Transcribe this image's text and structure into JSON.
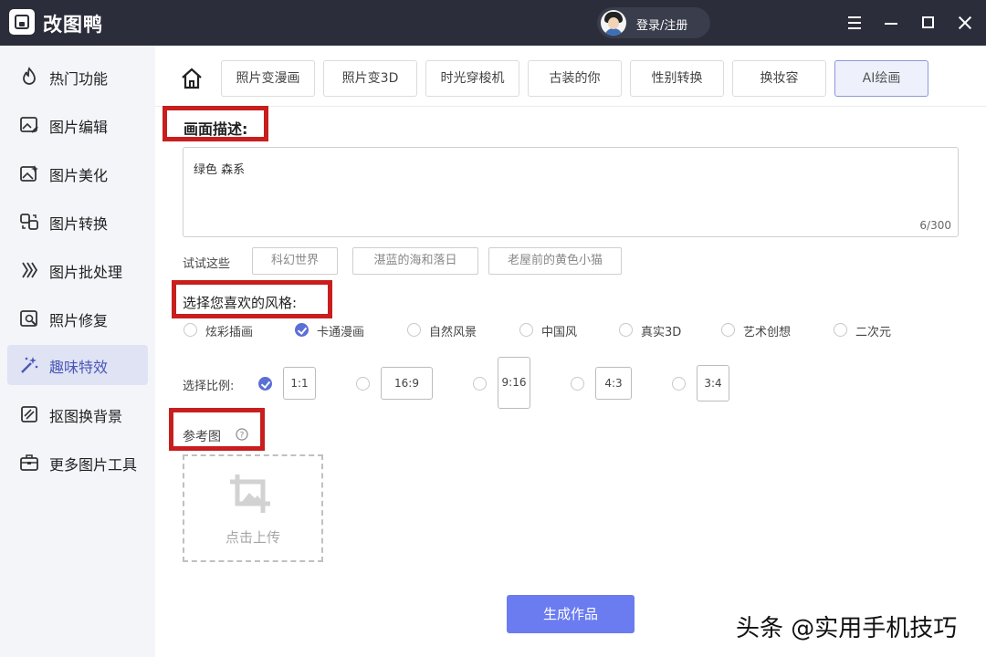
{
  "app": {
    "title": "改图鸭",
    "login_label": "登录/注册"
  },
  "sidebar": {
    "items": [
      {
        "label": "热门功能",
        "icon": "flame-icon"
      },
      {
        "label": "图片编辑",
        "icon": "image-edit-icon"
      },
      {
        "label": "图片美化",
        "icon": "image-beauty-icon"
      },
      {
        "label": "图片转换",
        "icon": "convert-icon"
      },
      {
        "label": "图片批处理",
        "icon": "batch-icon"
      },
      {
        "label": "照片修复",
        "icon": "repair-icon"
      },
      {
        "label": "趣味特效",
        "icon": "magic-wand-icon",
        "active": true
      },
      {
        "label": "抠图换背景",
        "icon": "cutout-icon"
      },
      {
        "label": "更多图片工具",
        "icon": "toolbox-icon"
      }
    ]
  },
  "tabs": [
    {
      "label": "照片变漫画"
    },
    {
      "label": "照片变3D"
    },
    {
      "label": "时光穿梭机"
    },
    {
      "label": "古装的你"
    },
    {
      "label": "性别转换"
    },
    {
      "label": "换妆容"
    },
    {
      "label": "AI绘画",
      "active": true
    }
  ],
  "description": {
    "title": "画面描述:",
    "value": "绿色 森系",
    "count": "6/300"
  },
  "suggestions": {
    "label": "试试这些",
    "items": [
      "科幻世界",
      "湛蓝的海和落日",
      "老屋前的黄色小猫"
    ]
  },
  "style": {
    "title": "选择您喜欢的风格:",
    "options": [
      "炫彩插画",
      "卡通漫画",
      "自然风景",
      "中国风",
      "真实3D",
      "艺术创想",
      "二次元"
    ],
    "selected": "卡通漫画"
  },
  "ratio": {
    "label": "选择比例:",
    "options": [
      "1:1",
      "16:9",
      "9:16",
      "4:3",
      "3:4"
    ],
    "selected": "1:1"
  },
  "reference": {
    "title": "参考图",
    "help_icon": "question-circle-icon",
    "upload_label": "点击上传"
  },
  "generate_label": "生成作品",
  "watermark": "头条 @实用手机技巧",
  "colors": {
    "titlebar": "#2b2d3a",
    "accent": "#6b7cf0",
    "highlight": "#c81e1e",
    "sidebar_active": "#dfe3f4"
  }
}
